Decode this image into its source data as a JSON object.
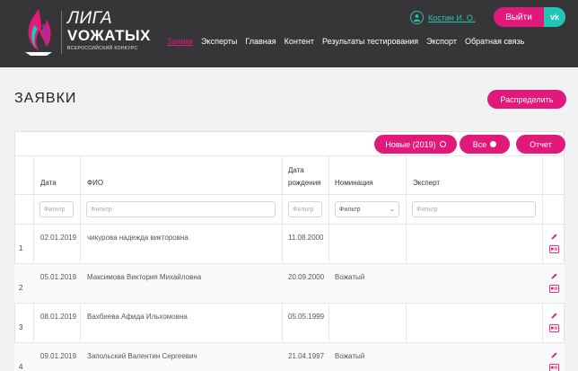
{
  "header": {
    "logo": {
      "line1": "ЛИГА",
      "line2": "VОЖАТЫХ",
      "line3": "ВСЕРОССИЙСКИЙ КОНКУРС"
    },
    "nav": [
      {
        "label": "Заявки",
        "active": true
      },
      {
        "label": "Эксперты",
        "active": false
      },
      {
        "label": "Главная",
        "active": false
      },
      {
        "label": "Контент",
        "active": false
      },
      {
        "label": "Результаты тестирования",
        "active": false
      },
      {
        "label": "Экспорт",
        "active": false
      },
      {
        "label": "Обратная связь",
        "active": false
      }
    ],
    "user_name": "Костин И. О.",
    "exit_label": "Выйти",
    "vk_label": "vk"
  },
  "page": {
    "title": "ЗАЯВКИ",
    "distribute_label": "Распределить"
  },
  "filters": {
    "new_label": "Новые (2019)",
    "all_label": "Все",
    "report_label": "Отчет"
  },
  "table": {
    "headers": {
      "date": "Дата",
      "fio": "ФИО",
      "birth_line1": "Дата",
      "birth_line2": "рождения",
      "nomination": "Номинация",
      "expert": "Эксперт"
    },
    "filter_placeholder": "Фильтр",
    "nomination_filter": "Фильтр",
    "rows": [
      {
        "num": "1",
        "date": "02.01.2019",
        "fio": "чикурова надежда викторовна",
        "birth": "11.08.2000",
        "nomination": "",
        "expert": ""
      },
      {
        "num": "2",
        "date": "05.01.2019",
        "fio": "Максимова Виктория Михайловна",
        "birth": "20.09.2000",
        "nomination": "Вожатый",
        "expert": ""
      },
      {
        "num": "3",
        "date": "08.01.2019",
        "fio": "Вахбиева Афида Ильхомовна",
        "birth": "05.05.1999",
        "nomination": "",
        "expert": ""
      },
      {
        "num": "4",
        "date": "09.01.2019",
        "fio": "Запольский Валентин Сергеевич",
        "birth": "21.04.1997",
        "nomination": "Вожатый",
        "expert": ""
      }
    ]
  },
  "colors": {
    "accent": "#e0197a",
    "teal": "#20c8b3",
    "header_bg": "#363638"
  }
}
